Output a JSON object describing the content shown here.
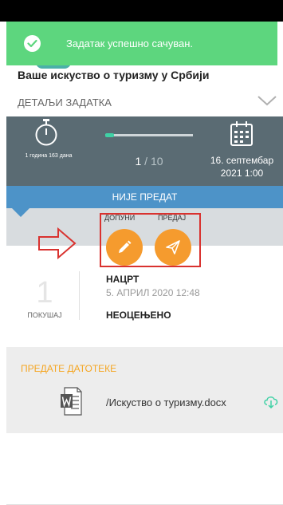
{
  "toast": {
    "message": "Задатак успешно сачуван.",
    "icon": "check-icon",
    "color": "#5dd67e"
  },
  "task": {
    "title": "Ваше искуство о туризму у Србији",
    "details_label": "ДЕТАЉИ ЗАДАТКА"
  },
  "info": {
    "time_remaining": "1 година 163 дана",
    "progress_current": "1",
    "progress_total": "10",
    "progress_fraction": 0.1,
    "due_date_line1": "16. септембар",
    "due_date_line2": "2021 1:00"
  },
  "status": {
    "label": "НИЈЕ ПРЕДАТ",
    "color": "#4d93c8"
  },
  "actions": {
    "edit_label": "ДОПУНИ",
    "submit_label": "ПРЕДАЈ",
    "accent": "#f59b2e",
    "highlight": "#d9322f"
  },
  "attempt": {
    "number": "1",
    "label": "ПОКУШАЈ",
    "draft_title": "НАЦРТ",
    "draft_date": "5. АПРИЛ 2020 12:48",
    "grade_status": "НЕОЦЕЊЕНО"
  },
  "files": {
    "title": "ПРЕДАТЕ ДАТОТЕКЕ",
    "items": [
      {
        "name": "/Искуство о туризму.docx",
        "icon": "word-doc-icon"
      }
    ]
  }
}
